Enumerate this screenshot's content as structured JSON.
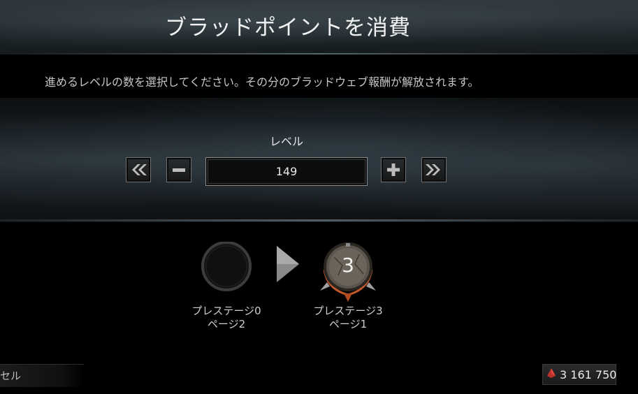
{
  "header": {
    "title": "ブラッドポイントを消費"
  },
  "instruction": "進めるレベルの数を選択してください。その分のブラッドウェブ報酬が解放されます。",
  "level": {
    "label": "レベル",
    "value": "149"
  },
  "buttons": {
    "decrease_max_icon": "double-chevron-left-icon",
    "decrease_icon": "minus-icon",
    "increase_icon": "plus-icon",
    "increase_max_icon": "double-chevron-right-icon"
  },
  "prestige": {
    "current": {
      "line1": "プレステージ0",
      "line2": "ページ2"
    },
    "target": {
      "line1": "プレステージ3",
      "line2": "ページ1",
      "badge_number": "3"
    }
  },
  "footer": {
    "cancel_label": "セル",
    "bloodpoints": "3 161 750",
    "bloodpoints_icon": "bloodpoint-drop-icon",
    "accent_color": "#c0392b"
  }
}
